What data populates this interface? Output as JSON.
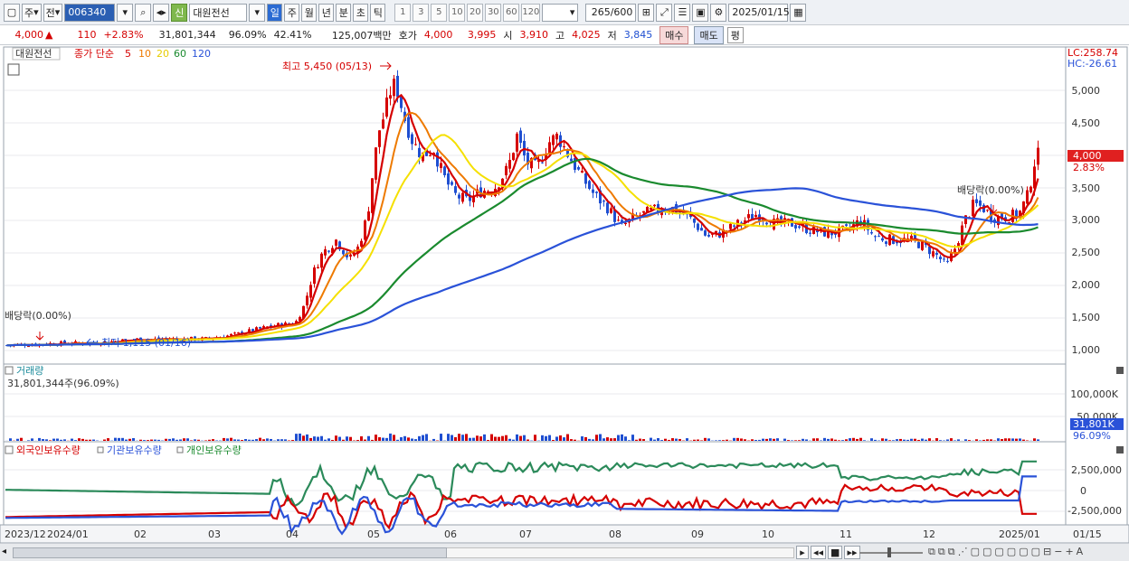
{
  "toolbar": {
    "market": "주",
    "mode": "전",
    "code": "006340",
    "name_tag": "신",
    "name": "대원전선",
    "periods": [
      "일",
      "주",
      "월",
      "년",
      "분",
      "초",
      "틱"
    ],
    "active_period": "일",
    "nums": [
      "1",
      "3",
      "5",
      "10",
      "20",
      "30",
      "60",
      "120"
    ],
    "count": "265",
    "count_total": "/600",
    "date": "2025/01/15"
  },
  "info": {
    "price": "4,000",
    "arrow": "▲",
    "change": "110",
    "rate": "+2.83%",
    "volume": "31,801,344",
    "vol_ratio": "96.09%",
    "turnover": "42.41%",
    "amount": "125,007백만",
    "ask_label": "호가",
    "ask": "4,000",
    "bid": "3,995",
    "open_label": "시",
    "open": "3,910",
    "high_label": "고",
    "high": "4,025",
    "low_label": "저",
    "low": "3,845",
    "buy": "매수",
    "sell": "매도",
    "flat": "평"
  },
  "price_panel": {
    "stock_label": "대원전선",
    "legend_title": "종가 단순",
    "legend_periods": [
      "5",
      "10",
      "20",
      "60",
      "120"
    ],
    "legend_colors": [
      "#d50000",
      "#ee7a00",
      "#f5e000",
      "#1a8a2e",
      "#2a52d8"
    ],
    "lc": "LC:258.74",
    "hc": "HC:-26.61",
    "y_ticks": [
      "5,000",
      "4,500",
      "4,000",
      "3,500",
      "3,000",
      "2,500",
      "2,000",
      "1,500",
      "1,000"
    ],
    "current_price": "4,000",
    "current_rate": "2.83%",
    "high_annot": "최고 5,450 (05/13)",
    "low_annot": "최저 1,115 (01/16)",
    "dividend1": "배당락(0.00%)",
    "dividend2": "배당락(0.00%)"
  },
  "volume_panel": {
    "title": "거래량",
    "summary": "31,801,344주(96.09%)",
    "y_ticks": [
      "100,000K",
      "50,000K"
    ],
    "current": "31,801K",
    "current_rate": "96.09%"
  },
  "holdings_panel": {
    "legend": [
      "외국인보유수량",
      "기관보유수량",
      "개인보유수량"
    ],
    "legend_colors": [
      "#d50000",
      "#2a52d8",
      "#1a8a2e"
    ],
    "y_ticks": [
      "2,500,000",
      "0",
      "-2,500,000"
    ]
  },
  "x_axis": {
    "labels": [
      "2023/12",
      "2024/01",
      "02",
      "03",
      "04",
      "05",
      "06",
      "07",
      "08",
      "09",
      "10",
      "11",
      "12",
      "2025/01",
      "01/15"
    ]
  }
}
